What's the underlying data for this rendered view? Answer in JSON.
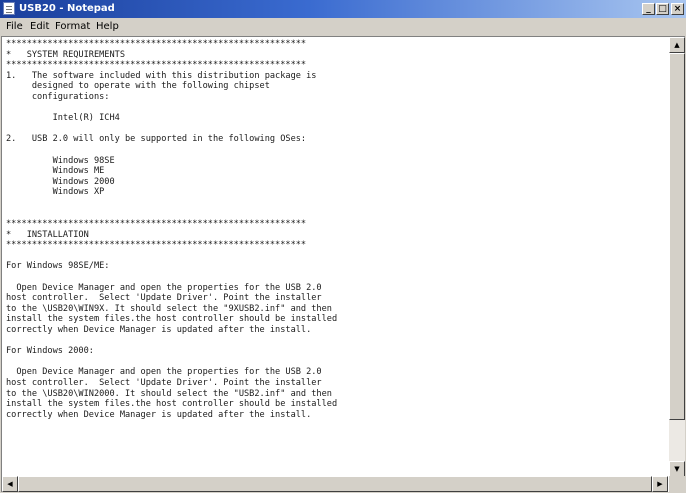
{
  "window": {
    "title": "USB20 - Notepad",
    "controls": {
      "minimize": "_",
      "maximize": "□",
      "close": "×"
    }
  },
  "menu": [
    "File",
    "Edit",
    "Format",
    "Help"
  ],
  "document_text": "**********************************************************\n*   SYSTEM REQUIREMENTS\n**********************************************************\n1.   The software included with this distribution package is\n     designed to operate with the following chipset\n     configurations:\n\n         Intel(R) ICH4\n\n2.   USB 2.0 will only be supported in the following OSes:\n\n         Windows 98SE\n         Windows ME\n         Windows 2000\n         Windows XP\n\n\n**********************************************************\n*   INSTALLATION\n**********************************************************\n\nFor Windows 98SE/ME:\n\n  Open Device Manager and open the properties for the USB 2.0\nhost controller.  Select 'Update Driver'. Point the installer\nto the \\USB20\\WIN9X. It should select the \"9XUSB2.inf\" and then\ninstall the system files.the host controller should be installed\ncorrectly when Device Manager is updated after the install.\n\nFor Windows 2000:\n\n  Open Device Manager and open the properties for the USB 2.0\nhost controller.  Select 'Update Driver'. Point the installer\nto the \\USB20\\WIN2000. It should select the \"USB2.inf\" and then\ninstall the system files.the host controller should be installed\ncorrectly when Device Manager is updated after the install.",
  "scrollbars": {
    "vertical": {
      "position": 0.0,
      "visible_fraction": 0.9
    },
    "horizontal": {
      "position": 0.0,
      "visible_fraction": 1.0
    }
  },
  "colors": {
    "titlebar_start": "#1b3f9c",
    "titlebar_end": "#a9c6f0",
    "chrome": "#d4d0c8",
    "text": "#1a1a1a"
  }
}
